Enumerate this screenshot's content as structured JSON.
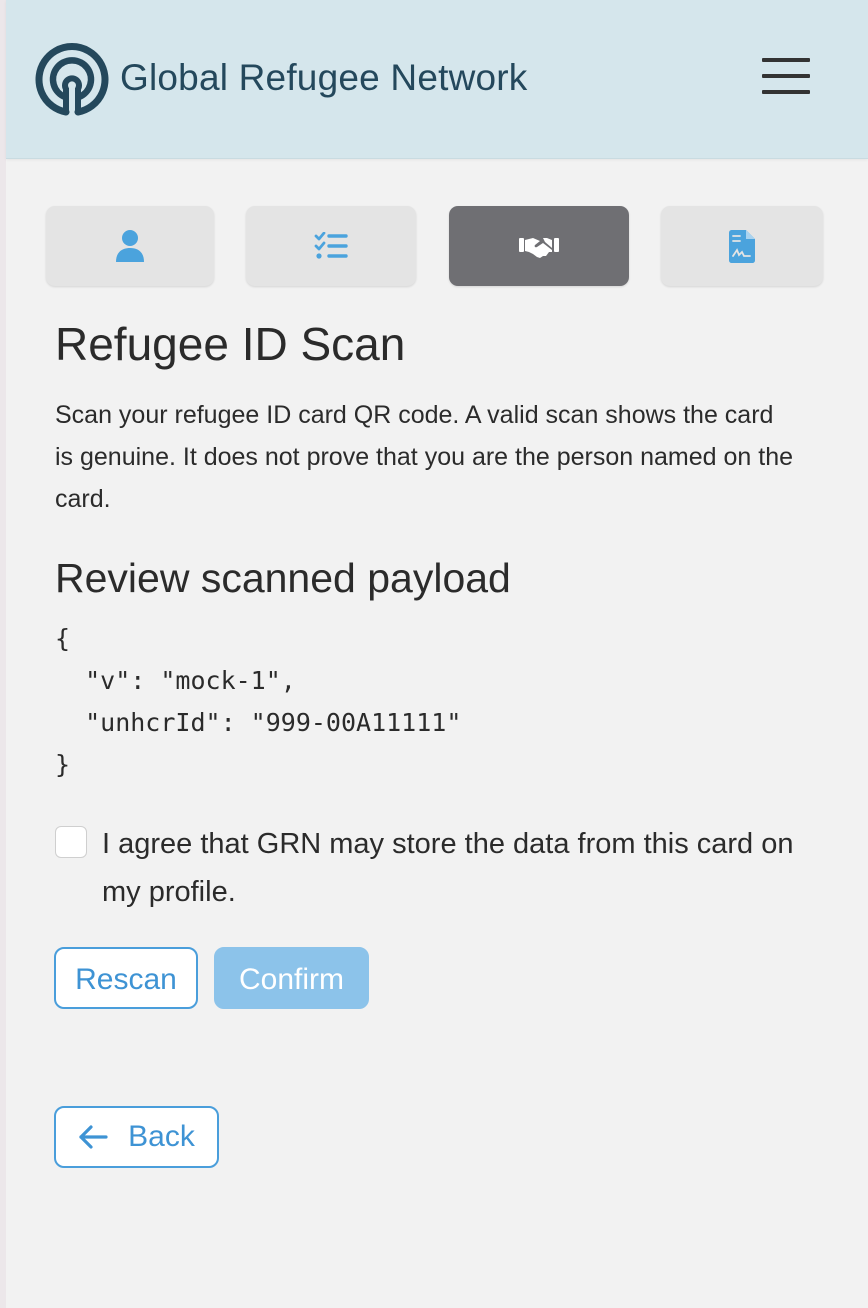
{
  "header": {
    "brand_name": "Global Refugee Network",
    "logo_icon": "grn-logo-icon",
    "menu_icon": "hamburger-menu-icon"
  },
  "steps": [
    {
      "icon": "user-icon",
      "active": false
    },
    {
      "icon": "checklist-icon",
      "active": false
    },
    {
      "icon": "handshake-icon",
      "active": true
    },
    {
      "icon": "signed-document-icon",
      "active": false
    }
  ],
  "main": {
    "title": "Refugee ID Scan",
    "description": "Scan your refugee ID card QR code. A valid scan shows the card is genuine. It does not prove that you are the person named on the card.",
    "payload_title": "Review scanned payload",
    "payload": {
      "open": "{",
      "line1": "  \"v\": \"mock-1\",",
      "line2": "  \"unhcrId\": \"999-00A11111\"",
      "close": "}"
    },
    "consent": {
      "checked": false,
      "label": "I agree that GRN may store the data from this card on my profile."
    },
    "rescan_label": "Rescan",
    "confirm_label": "Confirm",
    "back_label": "Back"
  },
  "colors": {
    "header_bg": "#d5e6ec",
    "brand_text": "#24485c",
    "accent": "#4a9edb",
    "confirm_disabled": "#8cc3ea",
    "active_step": "#6f6f73",
    "page_bg": "#f2f2f2"
  }
}
